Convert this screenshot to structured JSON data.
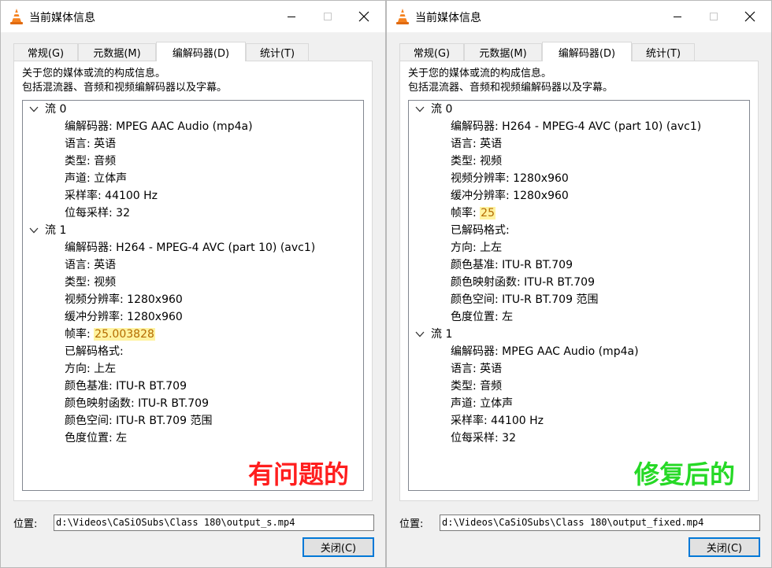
{
  "left": {
    "title": "当前媒体信息",
    "tabs": [
      "常规(G)",
      "元数据(M)",
      "编解码器(D)",
      "统计(T)"
    ],
    "description": [
      "关于您的媒体或流的构成信息。",
      "包括混流器、音频和视频编解码器以及字幕。"
    ],
    "streams": [
      {
        "label": "流 0",
        "props": [
          {
            "text": "编解码器: MPEG AAC Audio (mp4a)"
          },
          {
            "text": "语言: 英语"
          },
          {
            "text": "类型: 音频"
          },
          {
            "text": "声道: 立体声"
          },
          {
            "text": "采样率: 44100 Hz"
          },
          {
            "text": "位每采样: 32"
          }
        ]
      },
      {
        "label": "流 1",
        "props": [
          {
            "text": "编解码器: H264 - MPEG-4 AVC (part 10) (avc1)"
          },
          {
            "text": "语言: 英语"
          },
          {
            "text": "类型: 视频"
          },
          {
            "text": "视频分辨率: 1280x960"
          },
          {
            "text": "缓冲分辨率: 1280x960"
          },
          {
            "prefix": "帧率: ",
            "highlight": "25.003828"
          },
          {
            "text": "已解码格式:"
          },
          {
            "text": "方向: 上左"
          },
          {
            "text": "颜色基准: ITU-R BT.709"
          },
          {
            "text": "颜色映射函数: ITU-R BT.709"
          },
          {
            "text": "颜色空间: ITU-R BT.709 范围"
          },
          {
            "text": "色度位置: 左"
          }
        ]
      }
    ],
    "overlay": "有问题的",
    "location_label": "位置:",
    "location_value": "d:\\Videos\\CaSiOSubs\\Class 180\\output_s.mp4",
    "close_label": "关闭(C)"
  },
  "right": {
    "title": "当前媒体信息",
    "tabs": [
      "常规(G)",
      "元数据(M)",
      "编解码器(D)",
      "统计(T)"
    ],
    "description": [
      "关于您的媒体或流的构成信息。",
      "包括混流器、音频和视频编解码器以及字幕。"
    ],
    "streams": [
      {
        "label": "流 0",
        "props": [
          {
            "text": "编解码器: H264 - MPEG-4 AVC (part 10) (avc1)"
          },
          {
            "text": "语言: 英语"
          },
          {
            "text": "类型: 视频"
          },
          {
            "text": "视频分辨率: 1280x960"
          },
          {
            "text": "缓冲分辨率: 1280x960"
          },
          {
            "prefix": "帧率: ",
            "highlight": "25"
          },
          {
            "text": "已解码格式:"
          },
          {
            "text": "方向: 上左"
          },
          {
            "text": "颜色基准: ITU-R BT.709"
          },
          {
            "text": "颜色映射函数: ITU-R BT.709"
          },
          {
            "text": "颜色空间: ITU-R BT.709 范围"
          },
          {
            "text": "色度位置: 左"
          }
        ]
      },
      {
        "label": "流 1",
        "props": [
          {
            "text": "编解码器: MPEG AAC Audio (mp4a)"
          },
          {
            "text": "语言: 英语"
          },
          {
            "text": "类型: 音频"
          },
          {
            "text": "声道: 立体声"
          },
          {
            "text": "采样率: 44100 Hz"
          },
          {
            "text": "位每采样: 32"
          }
        ]
      }
    ],
    "overlay": "修复后的",
    "location_label": "位置:",
    "location_value": "d:\\Videos\\CaSiOSubs\\Class 180\\output_fixed.mp4",
    "close_label": "关闭(C)"
  },
  "colors": {
    "accent": "#0078d7",
    "highlight_bg": "#fff3a0",
    "highlight_text": "#b46b00",
    "overlay_red": "#ff1e1e",
    "overlay_green": "#26d926"
  },
  "icons": {
    "app": "vlc-cone-icon",
    "expand": "chevron-down-icon",
    "minimize": "minimize-icon",
    "maximize": "maximize-icon",
    "close": "close-icon"
  }
}
